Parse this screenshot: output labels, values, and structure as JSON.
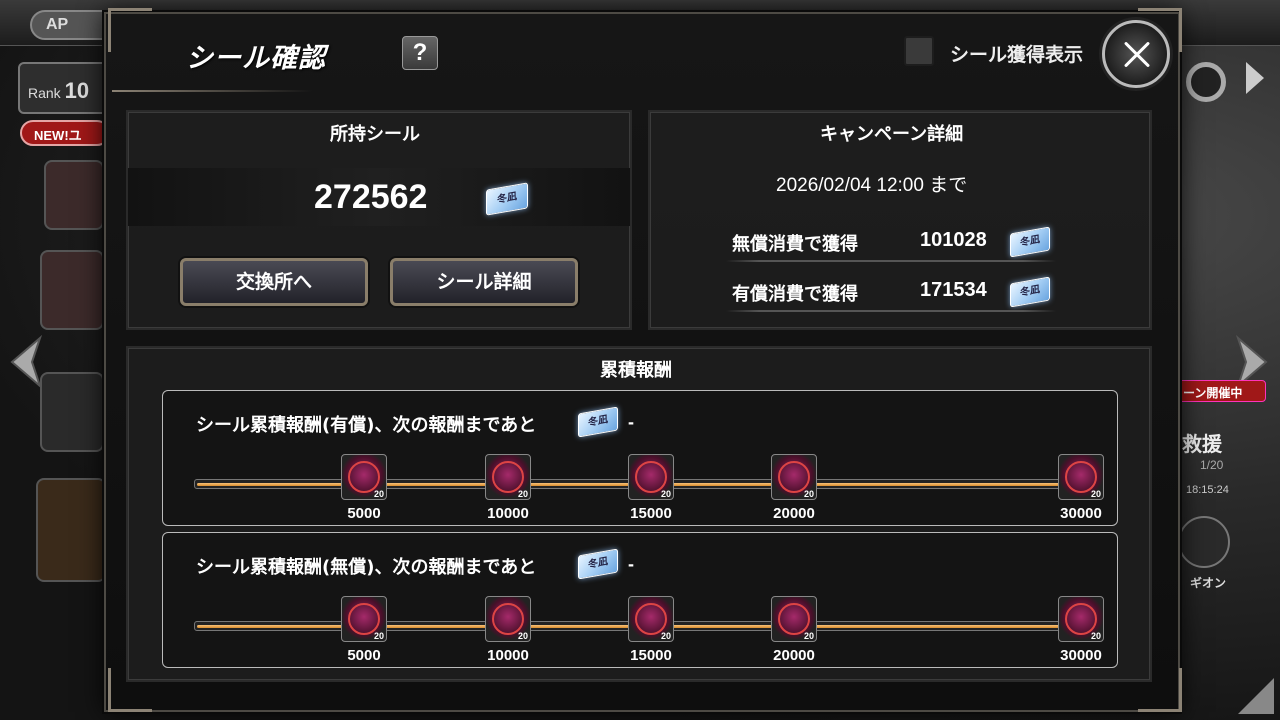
{
  "hud": {
    "ap_label": "AP",
    "rank_label": "Rank",
    "rank_value": "10",
    "new_tag": "NEW!ユ",
    "event_tag": "ーン開催中",
    "rescue_label": "救援",
    "rescue_count": "1/20",
    "rescue_time": "18:15:24",
    "legion_label": "ギオン"
  },
  "dialog": {
    "title": "シール確認",
    "help_label": "?",
    "toggle_label": "シール獲得表示",
    "toggle_checked": false
  },
  "owned": {
    "heading": "所持シール",
    "count": "272562",
    "ticket_icon": "seal-ticket-icon",
    "exchange_button": "交換所へ",
    "detail_button": "シール詳細"
  },
  "campaign": {
    "heading": "キャンペーン詳細",
    "period": "2026/02/04 12:00 まで",
    "rows": [
      {
        "label": "無償消費で獲得",
        "value": "101028"
      },
      {
        "label": "有償消費で獲得",
        "value": "171534"
      }
    ]
  },
  "rewards": {
    "heading": "累積報酬",
    "tracks": [
      {
        "title": "シール累積報酬(有償)、次の報酬まであと",
        "remaining": "-",
        "milestones": [
          {
            "label": "5000",
            "reward_count": "20"
          },
          {
            "label": "10000",
            "reward_count": "20"
          },
          {
            "label": "15000",
            "reward_count": "20"
          },
          {
            "label": "20000",
            "reward_count": "20"
          },
          {
            "label": "30000",
            "reward_count": "20"
          }
        ]
      },
      {
        "title": "シール累積報酬(無償)、次の報酬まであと",
        "remaining": "-",
        "milestones": [
          {
            "label": "5000",
            "reward_count": "20"
          },
          {
            "label": "10000",
            "reward_count": "20"
          },
          {
            "label": "15000",
            "reward_count": "20"
          },
          {
            "label": "20000",
            "reward_count": "20"
          },
          {
            "label": "30000",
            "reward_count": "20"
          }
        ]
      }
    ]
  },
  "colors": {
    "track_fill": "#d98c2c",
    "button_border": "#8a7e6a",
    "ticket": "#a8d0f5"
  }
}
